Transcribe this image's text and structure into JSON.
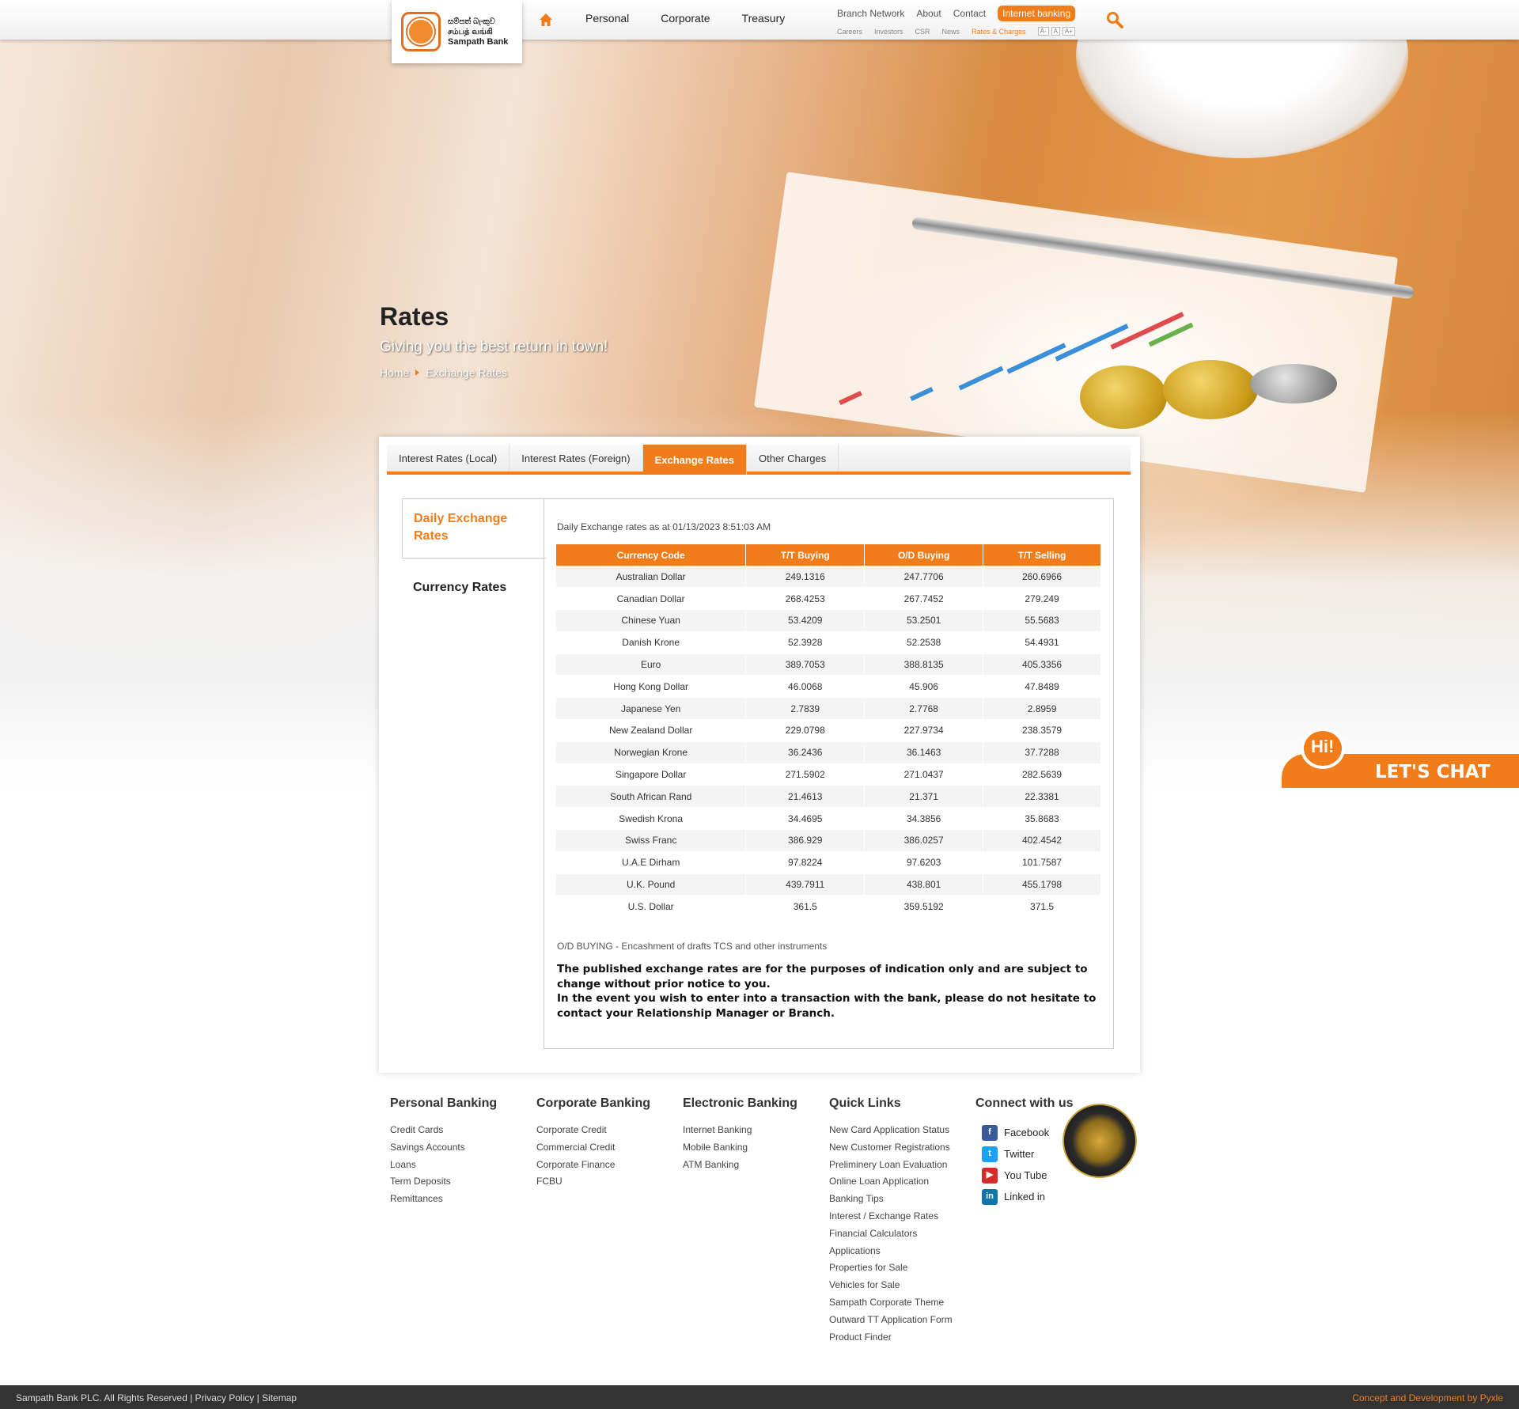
{
  "brand": {
    "logo_sinhala": "සම්පත් බැංකුව",
    "logo_tamil": "சம்பத் வங்கி",
    "logo_name": "Sampath Bank"
  },
  "nav": {
    "main": [
      "Personal",
      "Corporate",
      "Treasury"
    ],
    "top_links": [
      "Branch Network",
      "About",
      "Contact"
    ],
    "internet_banking": "Internet banking",
    "sub_links": [
      "Careers",
      "Investors",
      "CSR",
      "News"
    ],
    "rates_link": "Rates & Charges",
    "font_sizes": [
      "A-",
      "A",
      "A+"
    ]
  },
  "hero": {
    "title": "Rates",
    "subtitle": "Giving you the best return in town!",
    "breadcrumb_home": "Home",
    "breadcrumb_current": "Exchange Rates"
  },
  "tabs": [
    "Interest Rates (Local)",
    "Interest Rates (Foreign)",
    "Exchange Rates",
    "Other Charges"
  ],
  "side": {
    "active": "Daily Exchange Rates",
    "other": "Currency Rates"
  },
  "rates": {
    "as_at": "Daily Exchange rates as at 01/13/2023 8:51:03 AM",
    "headers": [
      "Currency Code",
      "T/T Buying",
      "O/D Buying",
      "T/T Selling"
    ],
    "rows": [
      [
        "Australian Dollar",
        "249.1316",
        "247.7706",
        "260.6966"
      ],
      [
        "Canadian Dollar",
        "268.4253",
        "267.7452",
        "279.249"
      ],
      [
        "Chinese Yuan",
        "53.4209",
        "53.2501",
        "55.5683"
      ],
      [
        "Danish Krone",
        "52.3928",
        "52.2538",
        "54.4931"
      ],
      [
        "Euro",
        "389.7053",
        "388.8135",
        "405.3356"
      ],
      [
        "Hong Kong Dollar",
        "46.0068",
        "45.906",
        "47.8489"
      ],
      [
        "Japanese Yen",
        "2.7839",
        "2.7768",
        "2.8959"
      ],
      [
        "New Zealand Dollar",
        "229.0798",
        "227.9734",
        "238.3579"
      ],
      [
        "Norwegian Krone",
        "36.2436",
        "36.1463",
        "37.7288"
      ],
      [
        "Singapore Dollar",
        "271.5902",
        "271.0437",
        "282.5639"
      ],
      [
        "South African Rand",
        "21.4613",
        "21.371",
        "22.3381"
      ],
      [
        "Swedish Krona",
        "34.4695",
        "34.3856",
        "35.8683"
      ],
      [
        "Swiss Franc",
        "386.929",
        "386.0257",
        "402.4542"
      ],
      [
        "U.A.E Dirham",
        "97.8224",
        "97.6203",
        "101.7587"
      ],
      [
        "U.K. Pound",
        "439.7911",
        "438.801",
        "455.1798"
      ],
      [
        "U.S. Dollar",
        "361.5",
        "359.5192",
        "371.5"
      ]
    ],
    "note": "O/D BUYING - Encashment of drafts TCS and other instruments",
    "disclaimer_1": "The published exchange rates are for the purposes of indication only and are subject to change without prior notice to you.",
    "disclaimer_2": "In the event you wish to enter into a transaction with the bank, please do not hesitate to contact your Relationship Manager or Branch."
  },
  "chat": {
    "bubble": "Hi!",
    "label": "LET'S CHAT"
  },
  "footer": {
    "columns": [
      {
        "title": "Personal Banking",
        "items": [
          "Credit Cards",
          "Savings Accounts",
          "Loans",
          "Term Deposits",
          "Remittances"
        ]
      },
      {
        "title": "Corporate Banking",
        "items": [
          "Corporate Credit",
          "Commercial Credit",
          "Corporate Finance",
          "FCBU"
        ]
      },
      {
        "title": "Electronic Banking",
        "items": [
          "Internet Banking",
          "Mobile Banking",
          "ATM Banking"
        ]
      },
      {
        "title": "Quick Links",
        "items": [
          "New Card Application Status",
          "New Customer Registrations",
          "Preliminery Loan Evaluation",
          "Online Loan Application",
          "Banking Tips",
          "Interest / Exchange Rates",
          "Financial Calculators",
          "Applications",
          "Properties for Sale",
          "Vehicles for Sale",
          "Sampath Corporate Theme",
          "Outward TT Application Form",
          "Product Finder"
        ]
      }
    ],
    "connect_title": "Connect with us",
    "social": [
      "Facebook",
      "Twitter",
      "You Tube",
      "Linked in"
    ],
    "copyright": "Sampath Bank PLC. All Rights Reserved | Privacy Policy | Sitemap",
    "credit": "Concept and Development by Pyxle"
  },
  "colors": {
    "accent": "#f07d1a",
    "dark": "#333333"
  }
}
